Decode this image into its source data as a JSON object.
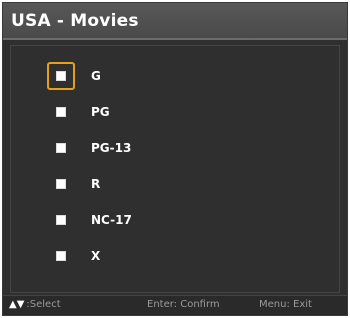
{
  "window": {
    "title": "USA - Movies"
  },
  "options": [
    {
      "label": "G"
    },
    {
      "label": "PG"
    },
    {
      "label": "PG-13"
    },
    {
      "label": "R"
    },
    {
      "label": "NC-17"
    },
    {
      "label": "X"
    }
  ],
  "footer": {
    "arrows": "▲▼",
    "select": ":Select",
    "confirm": "Enter: Confirm",
    "exit": "Menu: Exit"
  },
  "colors": {
    "focus_border": "#e3a11a"
  }
}
